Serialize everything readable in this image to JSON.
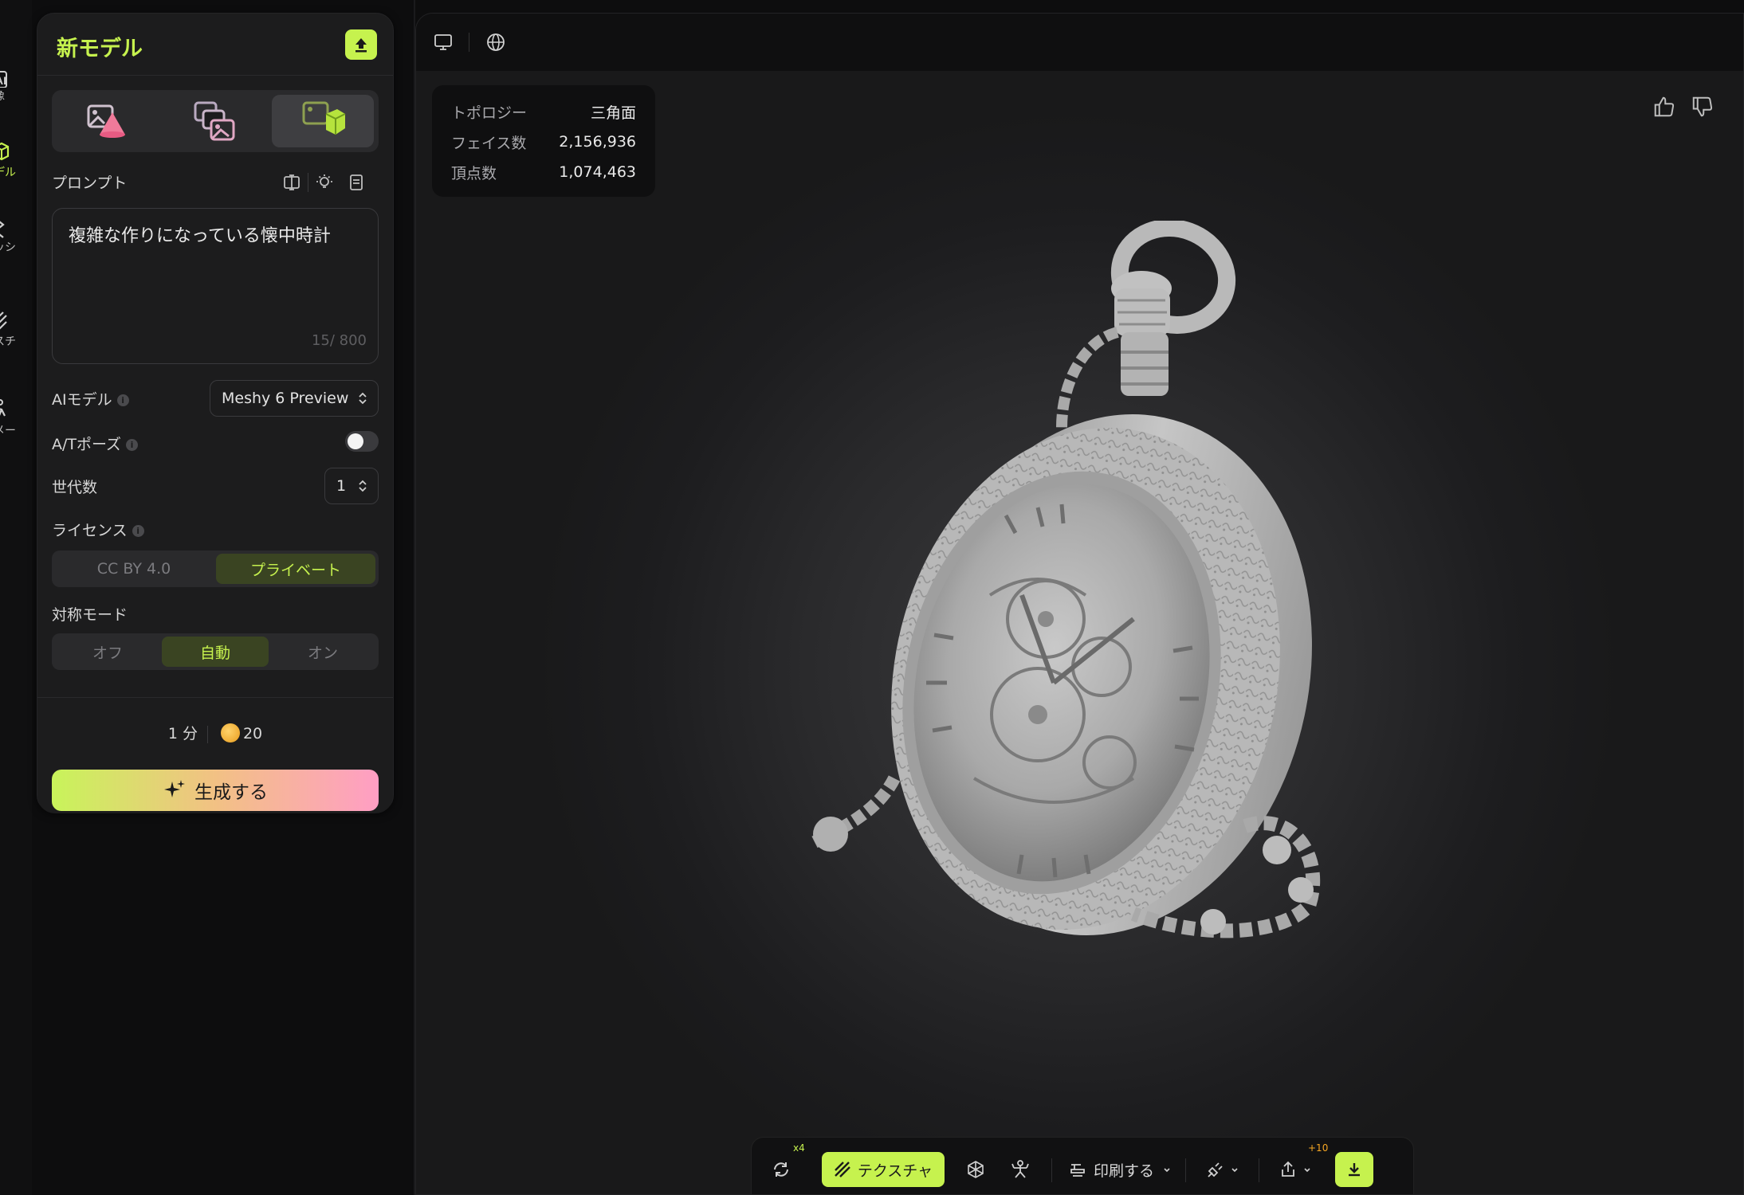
{
  "rail": {
    "items": [
      {
        "label": "像",
        "icon": "ai-image-icon"
      },
      {
        "label": "デル",
        "icon": "model-cube-icon",
        "active": true
      },
      {
        "label": "ッシ",
        "icon": "mesh-icon"
      },
      {
        "label": "スチ",
        "icon": "texture-icon"
      },
      {
        "label": "メー",
        "icon": "animation-icon"
      }
    ]
  },
  "panel": {
    "title": "新モデル",
    "modes": [
      "text-to-3d",
      "image-to-3d",
      "multi-image-to-3d"
    ],
    "prompt_label": "プロンプト",
    "prompt_text": "複雑な作りになっている懐中時計",
    "prompt_count": "15/ 800",
    "ai_model_label": "AIモデル",
    "ai_model_value": "Meshy 6 Preview",
    "at_pose_label": "A/Tポーズ",
    "generations_label": "世代数",
    "generations_value": "1",
    "license_label": "ライセンス",
    "license_options": [
      "CC BY 4.0",
      "プライベート"
    ],
    "symmetry_label": "対称モード",
    "symmetry_options": [
      "オフ",
      "自動",
      "オン"
    ],
    "time": "1 分",
    "cost": "20",
    "generate_label": "生成する"
  },
  "stats": {
    "topology_label": "トポロジー",
    "topology_value": "三角面",
    "faces_label": "フェイス数",
    "faces_value": "2,156,936",
    "vertices_label": "頂点数",
    "vertices_value": "1,074,463"
  },
  "toolbar": {
    "remesh_badge": "x4",
    "texture_label": "テクスチャ",
    "print_label": "印刷する",
    "share_badge": "+10"
  },
  "colors": {
    "accent": "#c6f24e",
    "panel": "#1c1c1d",
    "background": "#0d0d0e"
  }
}
